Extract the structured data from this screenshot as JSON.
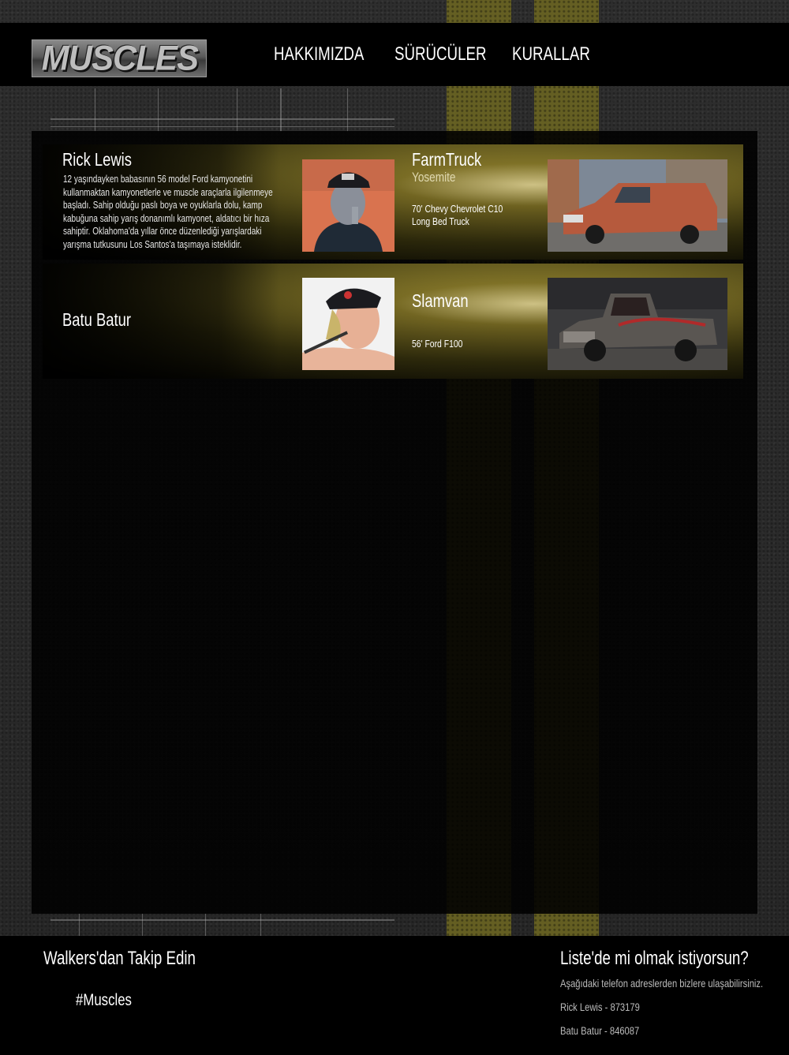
{
  "header": {
    "logo_text": "MUSCLES",
    "nav": [
      {
        "label": "HAKKIMIZDA"
      },
      {
        "label": "SÜRÜCÜLER"
      },
      {
        "label": "KURALLAR"
      }
    ]
  },
  "drivers": [
    {
      "name": "Rick Lewis",
      "description": "12 yaşındayken babasının 56 model Ford kamyonetini kullanmaktan kamyonetlerle ve muscle araçlarla ilgilenmeye başladı. Sahip olduğu paslı boya ve oyuklarla dolu, kamp kabuğuna sahip yarış donanımlı kamyonet, aldatıcı bir hıza sahiptir. Oklahoma'da yıllar önce düzenlediği yarışlardaki yarışma tutkusunu Los Santos'a taşımaya isteklidir.",
      "car_name": "FarmTruck",
      "car_sub": "Yosemite",
      "car_model": "70' Chevy Chevrolet C10 Long Bed Truck"
    },
    {
      "name": "Batu Batur",
      "description": "",
      "car_name": "Slamvan",
      "car_sub": "",
      "car_model": "56' Ford F100"
    }
  ],
  "footer": {
    "follow_title": "Walkers'dan Takip Edin",
    "hashtag": "#Muscles",
    "list_title": "Liste'de mi olmak istiyorsun?",
    "contact_intro": "Aşağıdaki telefon adreslerden bizlere ulaşabilirsiniz.",
    "contacts": [
      "Rick Lewis - 873179",
      "Batu Batur - 846087"
    ]
  },
  "colors": {
    "stripe_yellow": "#6b6522",
    "panel_bg": "#000000",
    "row_gold": "#8c7d2a"
  }
}
